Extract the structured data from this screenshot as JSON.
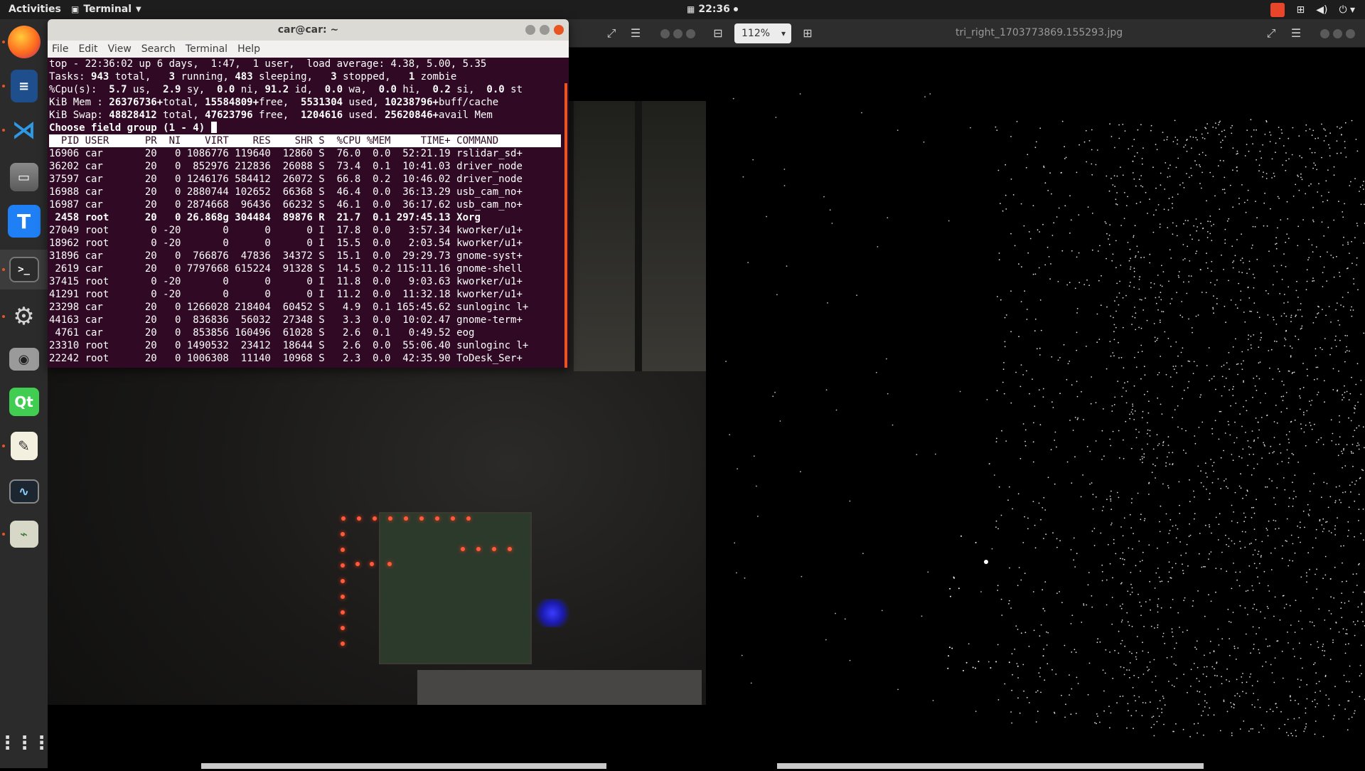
{
  "topbar": {
    "activities": "Activities",
    "app_name": "Terminal",
    "clock": "22:36"
  },
  "viewer": {
    "zoom": "112%",
    "title": "tri_right_1703773869.155293.jpg"
  },
  "terminal": {
    "title": "car@car: ~",
    "menu": [
      "File",
      "Edit",
      "View",
      "Search",
      "Terminal",
      "Help"
    ],
    "summary": {
      "line1": "top - 22:36:02 up 6 days,  1:47,  1 user,  load average: 4.38, 5.00, 5.35",
      "tasks_label": "Tasks: ",
      "tasks_total": "943",
      "tasks_total_label": " total,   ",
      "tasks_running": "3",
      "tasks_running_label": " running, ",
      "tasks_sleeping": "483",
      "tasks_sleeping_label": " sleeping,   ",
      "tasks_stopped": "3",
      "tasks_stopped_label": " stopped,   ",
      "tasks_zombie": "1",
      "tasks_zombie_label": " zombie",
      "cpu_label": "%Cpu(s):  ",
      "cpu_us": "5.7",
      "cpu_us_label": " us,  ",
      "cpu_sy": "2.9",
      "cpu_sy_label": " sy,  ",
      "cpu_ni": "0.0",
      "cpu_ni_label": " ni, ",
      "cpu_id": "91.2",
      "cpu_id_label": " id,  ",
      "cpu_wa": "0.0",
      "cpu_wa_label": " wa,  ",
      "cpu_hi": "0.0",
      "cpu_hi_label": " hi,  ",
      "cpu_si": "0.2",
      "cpu_si_label": " si,  ",
      "cpu_st": "0.0",
      "cpu_st_label": " st",
      "mem_label": "KiB Mem : ",
      "mem_total": "26376736+",
      "mem_total_label": "total, ",
      "mem_free": "15584809+",
      "mem_free_label": "free,  ",
      "mem_used": "5531304",
      "mem_used_label": " used, ",
      "mem_buff": "10238796+",
      "mem_buff_label": "buff/cache",
      "swap_label": "KiB Swap: ",
      "swap_total": "48828412",
      "swap_total_label": " total, ",
      "swap_free": "47623796",
      "swap_free_label": " free,  ",
      "swap_used": "1204616",
      "swap_used_label": " used. ",
      "swap_avail": "25620846+",
      "swap_avail_label": "avail Mem",
      "prompt": "Choose field group (1 - 4) "
    },
    "table_header": "  PID USER      PR  NI    VIRT    RES    SHR S  %CPU %MEM     TIME+ COMMAND     ",
    "rows": [
      "16906 car       20   0 1086776 119640  12860 S  76.0  0.0  52:21.19 rslidar_sd+",
      "36202 car       20   0  852976 212836  26088 S  73.4  0.1  10:41.03 driver_node",
      "37597 car       20   0 1246176 584412  26072 S  66.8  0.2  10:46.02 driver_node",
      "16988 car       20   0 2880744 102652  66368 S  46.4  0.0  36:13.29 usb_cam_no+",
      "16987 car       20   0 2874668  96436  66232 S  46.1  0.0  36:17.62 usb_cam_no+",
      " 2458 root      20   0 26.868g 304484  89876 R  21.7  0.1 297:45.13 Xorg",
      "27049 root       0 -20       0      0      0 I  17.8  0.0   3:57.34 kworker/u1+",
      "18962 root       0 -20       0      0      0 I  15.5  0.0   2:03.54 kworker/u1+",
      "31896 car       20   0  766876  47836  34372 S  15.1  0.0  29:29.73 gnome-syst+",
      " 2619 car       20   0 7797668 615224  91328 S  14.5  0.2 115:11.16 gnome-shell",
      "37415 root       0 -20       0      0      0 I  11.8  0.0   9:03.63 kworker/u1+",
      "41291 root       0 -20       0      0      0 I  11.2  0.0  11:32.18 kworker/u1+",
      "23298 car       20   0 1266028 218404  60452 S   4.9  0.1 165:45.62 sunloginc l+",
      "44163 car       20   0  836836  56032  27348 S   3.3  0.0  10:02.47 gnome-term+",
      " 4761 car       20   0  853856 160496  61028 S   2.6  0.1   0:49.52 eog",
      "23310 root      20   0 1490532  23412  18644 S   2.6  0.0  55:06.40 sunloginc l+",
      "22242 root      20   0 1006308  11140  10968 S   2.3  0.0  42:35.90 ToDesk_Ser+"
    ],
    "highlight_row": 5
  },
  "dock": {
    "items": [
      "firefox-icon",
      "writer-icon",
      "vscode-icon",
      "files-icon",
      "todesk-icon",
      "terminal-icon",
      "settings-icon",
      "camera-icon",
      "qt-icon",
      "text-editor-icon",
      "system-monitor-icon",
      "remmina-icon"
    ],
    "show_apps": "show-applications-icon"
  }
}
